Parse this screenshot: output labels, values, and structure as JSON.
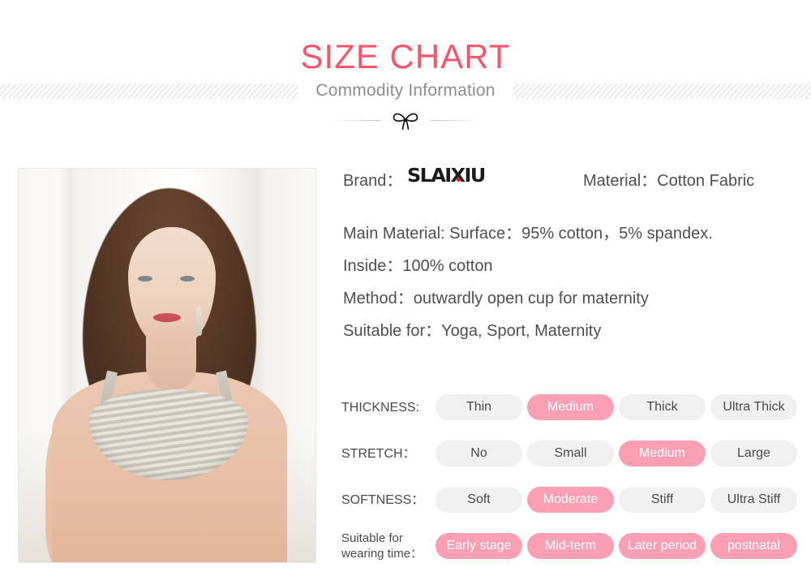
{
  "header": {
    "title": "SIZE CHART",
    "subtitle": "Commodity Information",
    "bow_icon": "bow-ribbon-icon"
  },
  "product_image": {
    "alt": "Woman wearing striped maternity bra, white paneled wall background"
  },
  "info": {
    "brand_label": "Brand：",
    "brand_logo": "SLAIXIU",
    "material_label": "Material：Cotton Fabric",
    "specs": [
      "Main Material: Surface：95% cotton，5% spandex.",
      "Inside：100% cotton",
      "Method：outwardly open cup for maternity",
      "Suitable for：Yoga, Sport, Maternity"
    ]
  },
  "attributes": [
    {
      "label": "THICKNESS:",
      "two_line": false,
      "options": [
        {
          "text": "Thin",
          "selected": false
        },
        {
          "text": "Medium",
          "selected": true
        },
        {
          "text": "Thick",
          "selected": false
        },
        {
          "text": "Ultra Thick",
          "selected": false
        }
      ]
    },
    {
      "label": "STRETCH：",
      "two_line": false,
      "options": [
        {
          "text": "No",
          "selected": false
        },
        {
          "text": "Small",
          "selected": false
        },
        {
          "text": "Medium",
          "selected": true
        },
        {
          "text": "Large",
          "selected": false
        }
      ]
    },
    {
      "label": "SOFTNESS：",
      "two_line": false,
      "options": [
        {
          "text": "Soft",
          "selected": false
        },
        {
          "text": "Moderate",
          "selected": true
        },
        {
          "text": "Stiff",
          "selected": false
        },
        {
          "text": "Ultra Stiff",
          "selected": false
        }
      ]
    },
    {
      "label": "Suitable for wearing time：",
      "two_line": true,
      "options": [
        {
          "text": "Early stage",
          "selected": true
        },
        {
          "text": "Mid-term",
          "selected": true
        },
        {
          "text": "Later period",
          "selected": true
        },
        {
          "text": "postnatal",
          "selected": true
        }
      ]
    }
  ],
  "colors": {
    "title_red": "#f4566e",
    "pill_selected": "#fba0b4",
    "pill_default": "#f0f0f0",
    "text": "#4a4a4a",
    "subtitle_gray": "#8d8d92",
    "logo_dot_red": "#d81f28"
  }
}
